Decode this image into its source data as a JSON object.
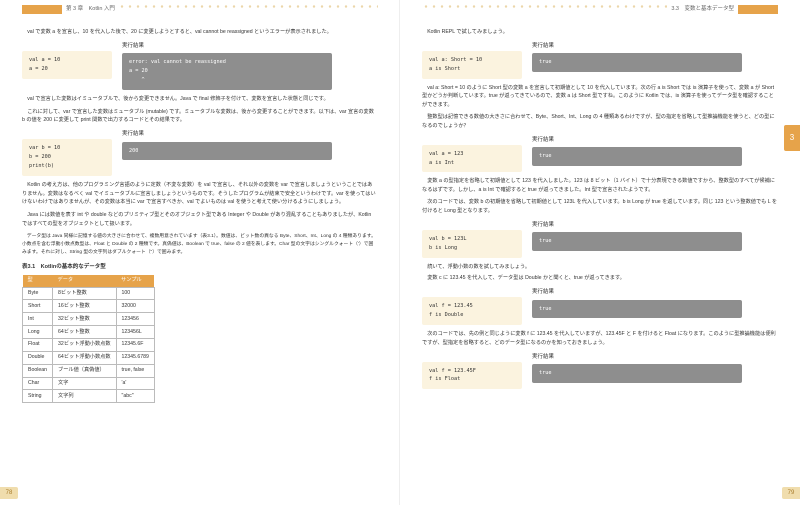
{
  "runhead": {
    "left": "第 3 章　Kotlin 入門",
    "right": "3.3　変数と基本データ型"
  },
  "pagenum": {
    "left": "78",
    "right": "79"
  },
  "thumb": "3",
  "left": {
    "p1": "val で変数 a を宣言し、10 を代入した後で、20 に変更しようとすると、val cannot be reassigned というエラーが表示されました。",
    "res_label": "実行結果",
    "code1": "val a = 10\na = 20",
    "res1": "error: val cannot be reassigned\na = 20\n    ^",
    "p2": "val で宣言した変数はイミュータブルで、後から変更できません。Java で final 修飾子を付けて、変数を宣言した状態と同じです。",
    "p3": "これに対して、var で宣言した変数はミュータブル (mutable) です。ミュータブルな変数は、後から変更することができます。以下は、var 宣言の変数 b の値を 200 に変更して print 関数で出力するコードとその結果です。",
    "code2": "var b = 10\nb = 200\nprint(b)",
    "res2": "200",
    "p4": "Kotlin の考え方は、他のプログラミング言語のように定数（不変な変数）を val で宣言し、それ以外の変数を var で宣言しましょうということではありません。変数はなるべく val でイミュータブルに宣言しましょうというものです。そうしたプログラムが結束で安全というわけです。var を使ってはいけないわけではありませんが、その変数は本当に var で宣言すべきか、val でよいものは val を使うと考えて使い分けるようにしましょう。",
    "p5": "Java には数値を表す int や double などのプリミティブ型とそのオブジェクト型である Integer や Double があり混乱することもありましたが、Kotlin ではすべての型をオブジェクトとして扱います。",
    "p6": "データ型は Java 同様に記憶する値の大きさに合わせて、複数用意されています（表3.1）。数値は、ビット数の異なる Byte、Short、Int、Long の 4 種類あります。小数点を含む浮動小数点数型は、Float と Double の 2 種類です。真偽値は、Boolean で true、false の 2 値を表します。Char 型の文字はシングルクォート（'）で囲みます。それに対し、String 型の文字列はダブルクォート（\"）で囲みます。",
    "tcaption": "表3.1　Kotlinの基本的なデータ型",
    "th": [
      "型",
      "データ",
      "サンプル"
    ],
    "rows": [
      [
        "Byte",
        "8ビット整数",
        "100"
      ],
      [
        "Short",
        "16ビット整数",
        "32000"
      ],
      [
        "Int",
        "32ビット整数",
        "123456"
      ],
      [
        "Long",
        "64ビット整数",
        "123456L"
      ],
      [
        "Float",
        "32ビット浮動小数点数",
        "12345.6F"
      ],
      [
        "Double",
        "64ビット浮動小数点数",
        "12345.6789"
      ],
      [
        "Boolean",
        "ブール値（真偽値）",
        "true, false"
      ],
      [
        "Char",
        "文字",
        "'a'"
      ],
      [
        "String",
        "文字列",
        "\"abc\""
      ]
    ]
  },
  "right": {
    "p1": "Kotlin REPL で試してみましょう。",
    "res_label": "実行結果",
    "code1": "val a: Short = 10\na is Short",
    "res1": "true",
    "p2": "val a: Short = 10 のように Short 型の変数 a を宣言して初期値として 10 を代入しています。次の行 a is Short では is 演算子を使って、変数 a が Short 型かどうか判断しています。true が返ってきているので、変数 a は Short 型ですね。このように Kotlin では、is 演算子を使ってデータ型を確認することができます。",
    "p3": "整数型は記憶できる数値の大きさに合わせて、Byte、Short、Int、Long の 4 種類あるわけですが、型の指定を省略して型推論機能を使うと、どの型になるのでしょうか？",
    "code2": "val a = 123\na is Int",
    "res2": "true",
    "p4": "変数 a の型指定を省略して初期値として 123 を代入しました。123 は 8 ビット（1 バイト）で十分表現できる数値ですから、整数型のすべてが候補になるはずです。しかし、a is Int で確認すると true が返ってきました。Int 型で宣言されたようです。",
    "p5": "次のコードでは、変数 b の初期値を省略して初期値として 123L を代入しています。b is Long が true を返しています。同じ 123 という整数値でも L を付けると Long 型となります。",
    "code3": "val b = 123L\nb is Long",
    "res3": "true",
    "p6": "続いて、浮動小数の数を試してみましょう。",
    "p7": "変数 c に 123.45 を代入して、データ型は Double かと聞くと、true が返ってきます。",
    "code4": "val f = 123.45\nf is Double",
    "res4": "true",
    "p8": "次のコードでは、先の例と同じように変数 f に 123.45 を代入していますが、123.45F と F を付けると Float になります。このように型推論機能は便利ですが、型指定を省略すると、どのデータ型になるのかを知っておきましょう。",
    "code5": "val f = 123.45F\nf is Float",
    "res5": "true"
  }
}
